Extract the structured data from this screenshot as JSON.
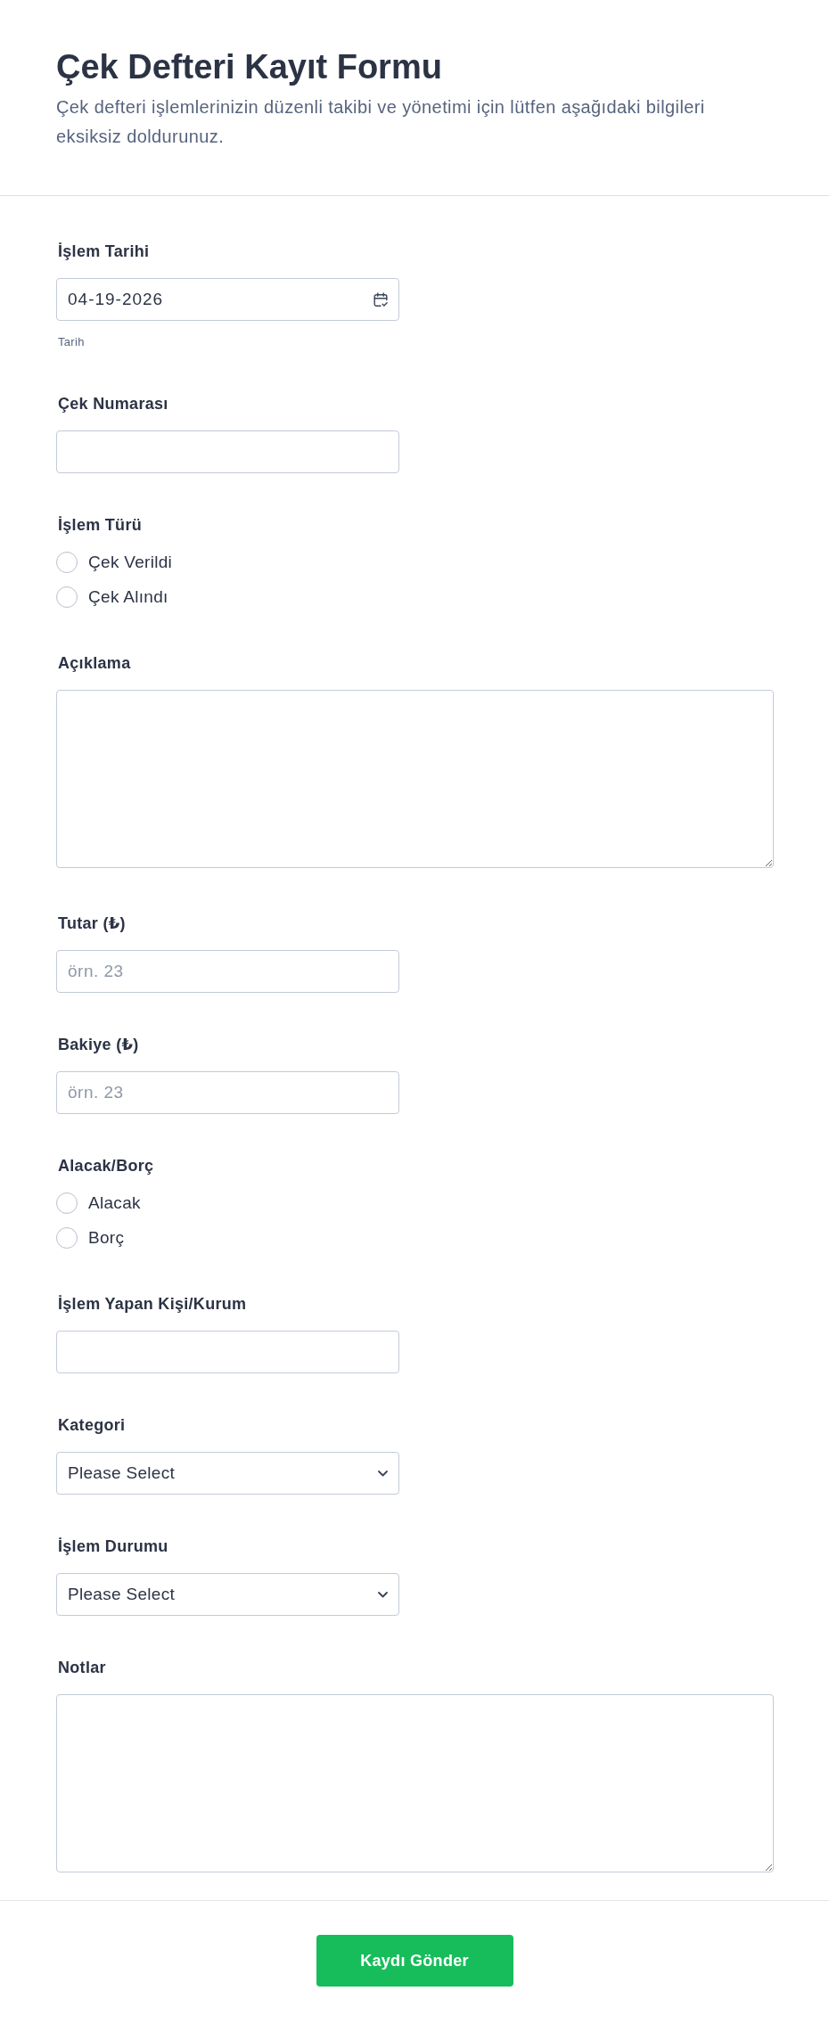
{
  "header": {
    "title": "Çek Defteri Kayıt Formu",
    "description": "Çek defteri işlemlerinizin düzenli takibi ve yönetimi için lütfen aşağıdaki bilgileri eksiksiz doldurunuz."
  },
  "fields": [
    {
      "kind": "date",
      "label": "İşlem Tarihi",
      "value": "04-19-2026",
      "sublabel": "Tarih"
    },
    {
      "kind": "text",
      "label": "Çek Numarası"
    },
    {
      "kind": "radio",
      "label": "İşlem Türü",
      "options": [
        {
          "label": "Çek Verildi",
          "selected": false
        },
        {
          "label": "Çek Alındı",
          "selected": false
        }
      ]
    },
    {
      "kind": "textarea",
      "label": "Açıklama"
    },
    {
      "kind": "number",
      "label": "Tutar (₺)",
      "placeholder": "örn. 23"
    },
    {
      "kind": "number",
      "label": "Bakiye (₺)",
      "placeholder": "örn. 23"
    },
    {
      "kind": "radio",
      "label": "Alacak/Borç",
      "options": [
        {
          "label": "Alacak",
          "selected": false
        },
        {
          "label": "Borç",
          "selected": false
        }
      ]
    },
    {
      "kind": "text",
      "label": "İşlem Yapan Kişi/Kurum"
    },
    {
      "kind": "select",
      "label": "Kategori",
      "value": "Please Select"
    },
    {
      "kind": "select",
      "label": "İşlem Durumu",
      "value": "Please Select"
    },
    {
      "kind": "textarea",
      "label": "Notlar"
    }
  ],
  "submit_button": {
    "label": "Kaydı Gönder"
  }
}
